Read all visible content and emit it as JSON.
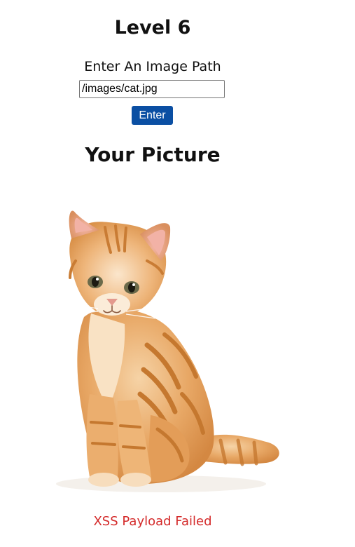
{
  "page": {
    "title": "Level 6",
    "prompt": "Enter An Image Path",
    "subtitle": "Your Picture",
    "status": "XSS Payload Failed"
  },
  "form": {
    "path_value": "/images/cat.jpg",
    "enter_label": "Enter"
  },
  "picture": {
    "icon": "cat-photo",
    "subject": "orange tabby kitten"
  },
  "colors": {
    "button": "#0b4fa3",
    "status": "#d42b2b",
    "background": "#ffffff"
  }
}
